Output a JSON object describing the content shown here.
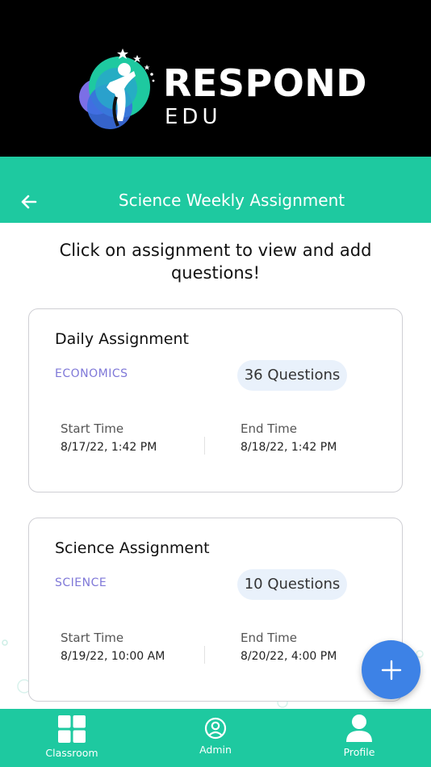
{
  "brand": {
    "name": "RESPOND",
    "sub": "EDU",
    "colors": {
      "teal": "#1ec9a0",
      "purple": "#7f78d8",
      "blue": "#3d82e6",
      "header_bg": "#000000"
    }
  },
  "header": {
    "title": "Science Weekly Assignment",
    "back_icon": "arrow-left-icon"
  },
  "instruction": "Click on assignment to view and add questions!",
  "assignments": [
    {
      "title": "Daily Assignment",
      "subject": "ECONOMICS",
      "questions": "36 Questions",
      "start_label": "Start Time",
      "start_value": "8/17/22, 1:42 PM",
      "end_label": "End Time",
      "end_value": "8/18/22, 1:42 PM"
    },
    {
      "title": "Science Assignment",
      "subject": "SCIENCE",
      "questions": "10 Questions",
      "start_label": "Start Time",
      "start_value": "8/19/22, 10:00 AM",
      "end_label": "End Time",
      "end_value": "8/20/22, 4:00 PM"
    }
  ],
  "fab": {
    "icon": "plus-icon"
  },
  "nav": {
    "items": [
      {
        "label": "Classroom",
        "icon": "grid-icon"
      },
      {
        "label": "Admin",
        "icon": "user-circle-icon"
      },
      {
        "label": "Profile",
        "icon": "person-icon"
      }
    ]
  }
}
